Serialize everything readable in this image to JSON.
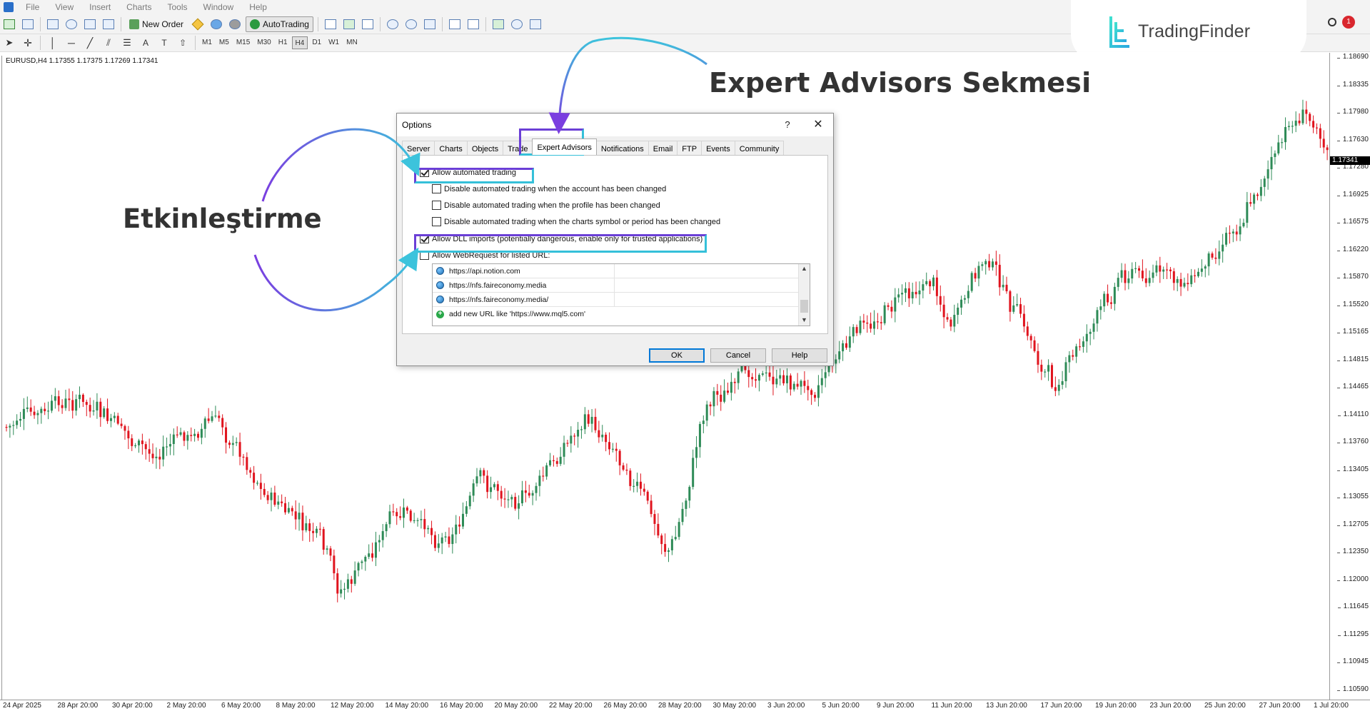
{
  "menubar": {
    "items": [
      "File",
      "View",
      "Insert",
      "Charts",
      "Tools",
      "Window",
      "Help"
    ]
  },
  "toolbar": {
    "new_order_label": "New Order",
    "autotrading_label": "AutoTrading",
    "timeframes": [
      "M1",
      "M5",
      "M15",
      "M30",
      "H1",
      "H4",
      "D1",
      "W1",
      "MN"
    ],
    "active_timeframe": "H4"
  },
  "logo": {
    "text": "TradingFinder"
  },
  "notification_count": "1",
  "chart": {
    "symbol_info": "EURUSD,H4  1.17355 1.17375 1.17269 1.17341",
    "current_price": "1.17341",
    "price_ticks": [
      "1.18690",
      "1.18335",
      "1.17980",
      "1.17630",
      "1.17280",
      "1.16925",
      "1.16575",
      "1.16220",
      "1.15870",
      "1.15520",
      "1.15165",
      "1.14815",
      "1.14465",
      "1.14110",
      "1.13760",
      "1.13405",
      "1.13055",
      "1.12705",
      "1.12350",
      "1.12000",
      "1.11645",
      "1.11295",
      "1.10945",
      "1.10590"
    ],
    "time_ticks": [
      "24 Apr 2025",
      "28 Apr 20:00",
      "30 Apr 20:00",
      "2 May 20:00",
      "6 May 20:00",
      "8 May 20:00",
      "12 May 20:00",
      "14 May 20:00",
      "16 May 20:00",
      "20 May 20:00",
      "22 May 20:00",
      "26 May 20:00",
      "28 May 20:00",
      "30 May 20:00",
      "3 Jun 20:00",
      "5 Jun 20:00",
      "9 Jun 20:00",
      "11 Jun 20:00",
      "13 Jun 20:00",
      "17 Jun 20:00",
      "19 Jun 20:00",
      "23 Jun 20:00",
      "25 Jun 20:00",
      "27 Jun 20:00",
      "1 Jul 20:00"
    ],
    "bull_color": "#2e8b57",
    "bear_color": "#e0141e"
  },
  "dialog": {
    "title": "Options",
    "help_glyph": "?",
    "close_glyph": "✕",
    "tabs": [
      "Server",
      "Charts",
      "Objects",
      "Trade",
      "Expert Advisors",
      "Notifications",
      "Email",
      "FTP",
      "Events",
      "Community"
    ],
    "selected_tab": "Expert Advisors",
    "options": [
      {
        "label": "Allow automated trading",
        "checked": true
      },
      {
        "label": "Disable automated trading when the account has been changed",
        "checked": false
      },
      {
        "label": "Disable automated trading when the profile has been changed",
        "checked": false
      },
      {
        "label": "Disable automated trading when the charts symbol or period has been changed",
        "checked": false
      },
      {
        "label": "Allow DLL imports (potentially dangerous, enable only for trusted applications)",
        "checked": true
      },
      {
        "label": "Allow WebRequest for listed URL:",
        "checked": false
      }
    ],
    "urls": [
      "https://api.notion.com",
      "https://nfs.faireconomy.media",
      "https://nfs.faireconomy.media/"
    ],
    "add_url_hint": "add new URL like 'https://www.mql5.com'",
    "buttons": {
      "ok": "OK",
      "cancel": "Cancel",
      "help": "Help"
    }
  },
  "annotations": {
    "expert_tab_label": "Expert Advisors Sekmesi",
    "enable_label": "Etkinleştirme",
    "highlight_colors": {
      "purple": "#6b3fd6",
      "cyan": "#35c0d9"
    }
  }
}
